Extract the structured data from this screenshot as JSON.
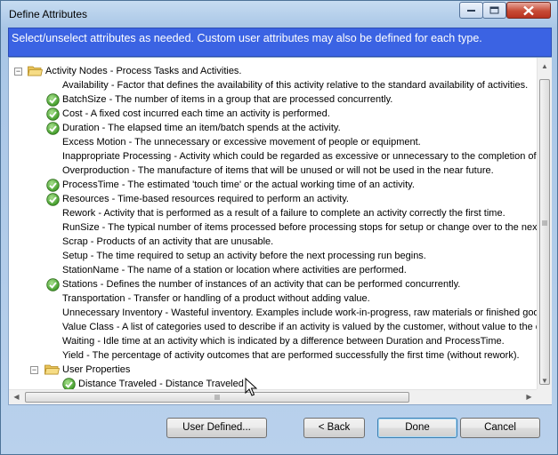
{
  "window": {
    "title": "Define Attributes"
  },
  "header": {
    "text": "Select/unselect attributes as needed.  Custom user attributes may also be defined for each type."
  },
  "tree": {
    "rows": [
      {
        "level": 0,
        "expander": "−",
        "folder": true,
        "checked": false,
        "label": "Activity Nodes - Process Tasks and Activities."
      },
      {
        "level": 1,
        "checked": false,
        "label": "Availability - Factor that defines the availability of this activity relative to the standard availability of activities."
      },
      {
        "level": 1,
        "checked": true,
        "label": "BatchSize - The number of items in a group that are processed concurrently."
      },
      {
        "level": 1,
        "checked": true,
        "label": "Cost - A fixed cost incurred each time an activity is performed."
      },
      {
        "level": 1,
        "checked": true,
        "label": "Duration - The elapsed time an item/batch spends at the activity."
      },
      {
        "level": 1,
        "checked": false,
        "label": "Excess Motion - The unnecessary or excessive movement of people or equipment."
      },
      {
        "level": 1,
        "checked": false,
        "label": "Inappropriate Processing - Activity which could be regarded as excessive or unnecessary to the completion of a p"
      },
      {
        "level": 1,
        "checked": false,
        "label": "Overproduction - The manufacture of items that will be unused or will not be used in the near future."
      },
      {
        "level": 1,
        "checked": true,
        "label": "ProcessTime - The estimated 'touch time' or the actual working time of an activity."
      },
      {
        "level": 1,
        "checked": true,
        "label": "Resources - Time-based resources required to perform an activity."
      },
      {
        "level": 1,
        "checked": false,
        "label": "Rework - Activity that is performed as a result of a failure to complete an activity correctly the first time."
      },
      {
        "level": 1,
        "checked": false,
        "label": "RunSize - The typical number of items processed before processing stops for setup or change over to the next iter"
      },
      {
        "level": 1,
        "checked": false,
        "label": "Scrap - Products of an activity that are unusable."
      },
      {
        "level": 1,
        "checked": false,
        "label": "Setup - The time required to setup an activity before the next processing run begins."
      },
      {
        "level": 1,
        "checked": false,
        "label": "StationName - The name of a station or location where activities are performed."
      },
      {
        "level": 1,
        "checked": true,
        "label": "Stations - Defines the number of instances of an activity that can be performed concurrently."
      },
      {
        "level": 1,
        "checked": false,
        "label": "Transportation - Transfer or handling of a product without adding value."
      },
      {
        "level": 1,
        "checked": false,
        "label": "Unnecessary Inventory - Wasteful inventory.  Examples include work-in-progress, raw materials or finished goods t"
      },
      {
        "level": 1,
        "checked": false,
        "label": "Value Class - A list of categories used to describe if an activity is valued by the customer, without value to the cust"
      },
      {
        "level": 1,
        "checked": false,
        "label": "Waiting - Idle time at an activity which is indicated by a difference between Duration and ProcessTime."
      },
      {
        "level": 1,
        "checked": false,
        "label": "Yield - The percentage of activity outcomes that are performed successfully the first time (without rework)."
      },
      {
        "level": 1,
        "expander": "−",
        "folder": true,
        "checked": false,
        "label": "User Properties"
      },
      {
        "level": 2,
        "checked": true,
        "label": "Distance Traveled - Distance Traveled"
      }
    ]
  },
  "buttons": {
    "user_defined": "User Defined...",
    "back": "< Back",
    "done": "Done",
    "cancel": "Cancel"
  },
  "colors": {
    "header_bg": "#3b63e3",
    "check_green": "#3e9a26"
  }
}
